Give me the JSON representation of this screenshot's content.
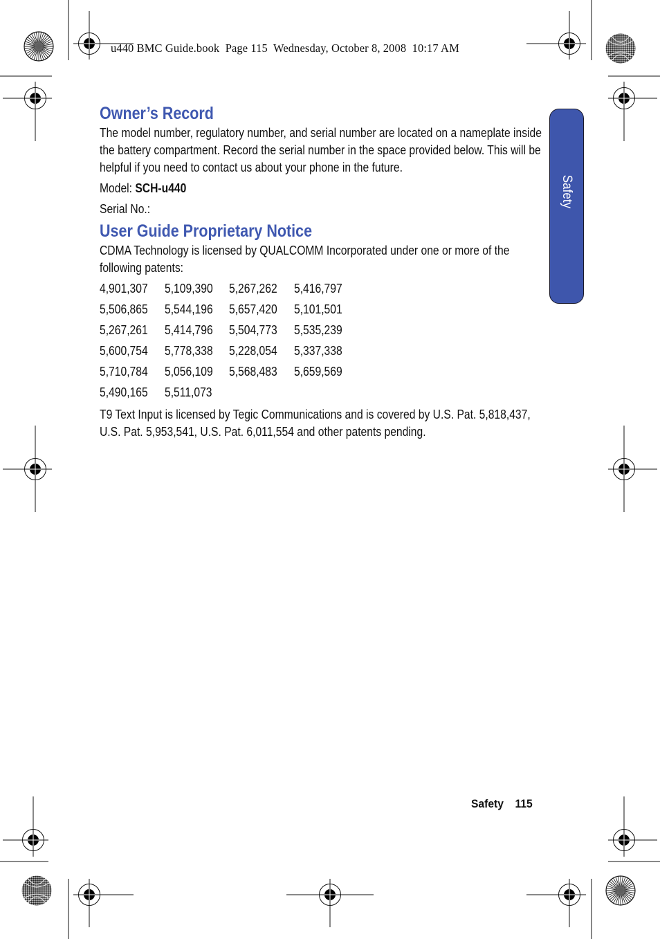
{
  "slug": {
    "text": "u440 BMC Guide.book  Page 115  Wednesday, October 8, 2008  10:17 AM"
  },
  "side_tab": {
    "label": "Safety",
    "color": "#3e56ac"
  },
  "heading_color": "#3f58b0",
  "owners_record": {
    "title": "Owner’s Record",
    "body": "The model number, regulatory number, and serial number are located on a nameplate inside the battery compartment. Record the serial number in the space provided below. This will be helpful if you need to contact us about your phone in the future.",
    "model_label": "Model: ",
    "model_value": "SCH-u440",
    "serial_label": "Serial No.:"
  },
  "proprietary_notice": {
    "title": "User Guide Proprietary Notice",
    "intro": "CDMA Technology is licensed by QUALCOMM Incorporated under one or more of the following patents:",
    "patents": [
      [
        "4,901,307",
        "5,109,390",
        "5,267,262",
        "5,416,797"
      ],
      [
        "5,506,865",
        "5,544,196",
        "5,657,420",
        "5,101,501"
      ],
      [
        "5,267,261",
        "5,414,796",
        "5,504,773",
        "5,535,239"
      ],
      [
        "5,600,754",
        "5,778,338",
        "5,228,054",
        "5,337,338"
      ],
      [
        "5,710,784",
        "5,056,109",
        "5,568,483",
        "5,659,569"
      ],
      [
        "5,490,165",
        "5,511,073"
      ]
    ],
    "t9_notice": "T9 Text Input is licensed by Tegic Communications and is covered by U.S. Pat. 5,818,437, U.S. Pat. 5,953,541, U.S. Pat. 6,011,554 and other patents pending."
  },
  "footer": {
    "section": "Safety",
    "page_number": "115"
  },
  "print_marks": {
    "registration_marks": "registration-target-icon",
    "starburst_marks": "starburst-icon",
    "moire_marks": "moire-circle-icon"
  }
}
